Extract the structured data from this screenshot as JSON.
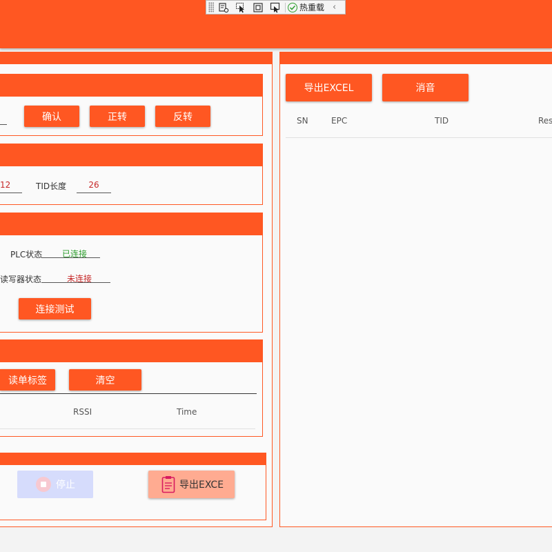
{
  "debug_toolbar": {
    "hot_reload_label": "热重载"
  },
  "direction_card": {
    "confirm_label": "确认",
    "forward_label": "正转",
    "reverse_label": "反转"
  },
  "length_card": {
    "epc_length_value": "12",
    "tid_length_label": "TID长度",
    "tid_length_value": "26"
  },
  "status_card": {
    "plc_status_label": "PLC状态",
    "plc_status_value": "已连接",
    "reader_status_label": "读写器状态",
    "reader_status_value": "未连接",
    "test_connection_label": "连接测试"
  },
  "single_read_card": {
    "read_single_label": "读单标签",
    "clear_label": "清空",
    "columns": [
      "RSSI",
      "Time"
    ]
  },
  "bottom_card": {
    "stop_label": "停止",
    "export_label": "导出EXCE"
  },
  "right_panel": {
    "export_excel_label": "导出EXCEL",
    "mute_label": "消音",
    "columns": [
      "SN",
      "EPC",
      "TID",
      "Res"
    ]
  },
  "colors": {
    "accent": "#ff5722",
    "connected": "#2e9e2e",
    "disconnected": "#c62828",
    "disabled_button": "#d6dcfc",
    "export_disabled": "#ffab91"
  }
}
